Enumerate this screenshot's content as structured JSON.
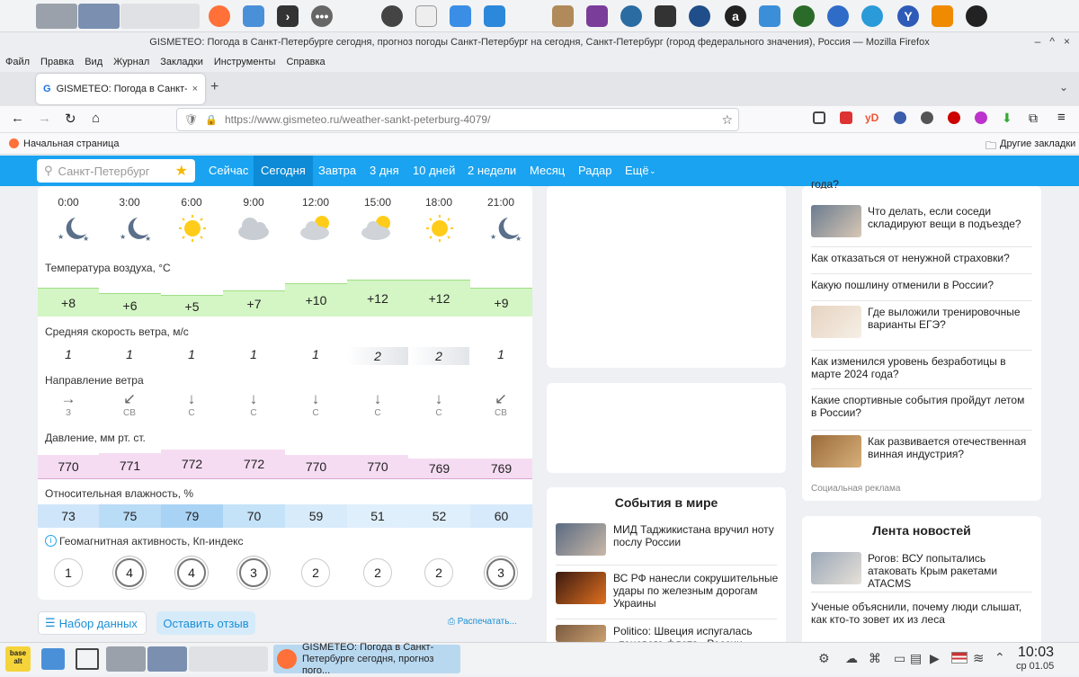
{
  "window": {
    "title": "GISMETEO: Погода в Санкт-Петербурге сегодня, прогноз погоды Санкт-Петербург на сегодня, Санкт-Петербург (город федерального значения), Россия — Mozilla Firefox"
  },
  "menu": [
    "Файл",
    "Правка",
    "Вид",
    "Журнал",
    "Закладки",
    "Инструменты",
    "Справка"
  ],
  "tab": {
    "label": "GISMETEO: Погода в Санкт-Пет"
  },
  "url": {
    "value": "https://www.gismeteo.ru/weather-sankt-peterburg-4079/"
  },
  "bookmarks": {
    "home": "Начальная страница",
    "other": "Другие закладки"
  },
  "site_nav": {
    "search_placeholder": "Санкт-Петербург",
    "links": [
      "Сейчас",
      "Сегодня",
      "Завтра",
      "3 дня",
      "10 дней",
      "2 недели",
      "Месяц",
      "Радар",
      "Ещё"
    ]
  },
  "forecast": {
    "times": [
      "0:00",
      "3:00",
      "6:00",
      "9:00",
      "12:00",
      "15:00",
      "18:00",
      "21:00"
    ],
    "icons": [
      "moon-stars-icon",
      "moon-stars-icon",
      "sun-icon",
      "cloud-icon",
      "partly-cloudy-icon",
      "partly-cloudy-icon",
      "sun-icon",
      "moon-stars-icon"
    ],
    "temp_label": "Температура воздуха, °C",
    "temps": [
      "+8",
      "+6",
      "+5",
      "+7",
      "+10",
      "+12",
      "+12",
      "+9"
    ],
    "wind_label": "Средняя скорость ветра, м/с",
    "wind": [
      "1",
      "1",
      "1",
      "1",
      "1",
      "2",
      "2",
      "1"
    ],
    "dir_label": "Направление ветра",
    "dir_arrows": [
      "→",
      "↙",
      "↓",
      "↓",
      "↓",
      "↓",
      "↓",
      "↙"
    ],
    "dir_names": [
      "З",
      "СВ",
      "С",
      "С",
      "С",
      "С",
      "С",
      "СВ"
    ],
    "pressure_label": "Давление, мм рт. ст.",
    "pressure": [
      "770",
      "771",
      "772",
      "772",
      "770",
      "770",
      "769",
      "769"
    ],
    "humidity_label": "Относительная влажность, %",
    "humidity": [
      "73",
      "75",
      "79",
      "70",
      "59",
      "51",
      "52",
      "60"
    ],
    "geo_label": "Геомагнитная активность, Кп-индекс",
    "geo": [
      "1",
      "4",
      "4",
      "3",
      "2",
      "2",
      "2",
      "3"
    ]
  },
  "actions": {
    "dataset": "Набор данных",
    "review": "Оставить отзыв",
    "print": "Распечатать..."
  },
  "right_col": {
    "top_cut": "года?",
    "items": [
      "Что делать, если соседи складируют вещи в подъезде?",
      "Как отказаться от ненужной страховки?",
      "Какую пошлину отменили в России?",
      "Где выложили тренировочные варианты ЕГЭ?",
      "Как изменился уровень безработицы в марте 2024 года?",
      "Какие спортивные события пройдут летом в России?",
      "Как развивается отечественная винная индустрия?"
    ],
    "ad_label": "Социальная реклама",
    "feed_title": "Лента новостей",
    "feed": [
      "Рогов: ВСУ попытались атаковать Крым ракетами ATACMS",
      "Ученые объяснили, почему люди слышат, как кто-то зовет их из леса"
    ]
  },
  "world_events": {
    "title": "События в мире",
    "items": [
      "МИД Таджикистана вручил ноту послу России",
      "ВС РФ нанесли сокрушительные удары по железным дорогам Украины",
      "Politico: Швеция испугалась «теневого флота» России"
    ]
  },
  "taskbar": {
    "window_label": "GISMETEO: Погода в Санкт-Петербурге сегодня, прогноз пого...",
    "clock": "10:03",
    "date": "ср 01.05",
    "start": "base alt"
  },
  "colors": {
    "brand": "#1aa3f0",
    "temp": "#d4f5c4",
    "pressure": "#f6dcf3",
    "humidity": "#cfe6fa"
  }
}
